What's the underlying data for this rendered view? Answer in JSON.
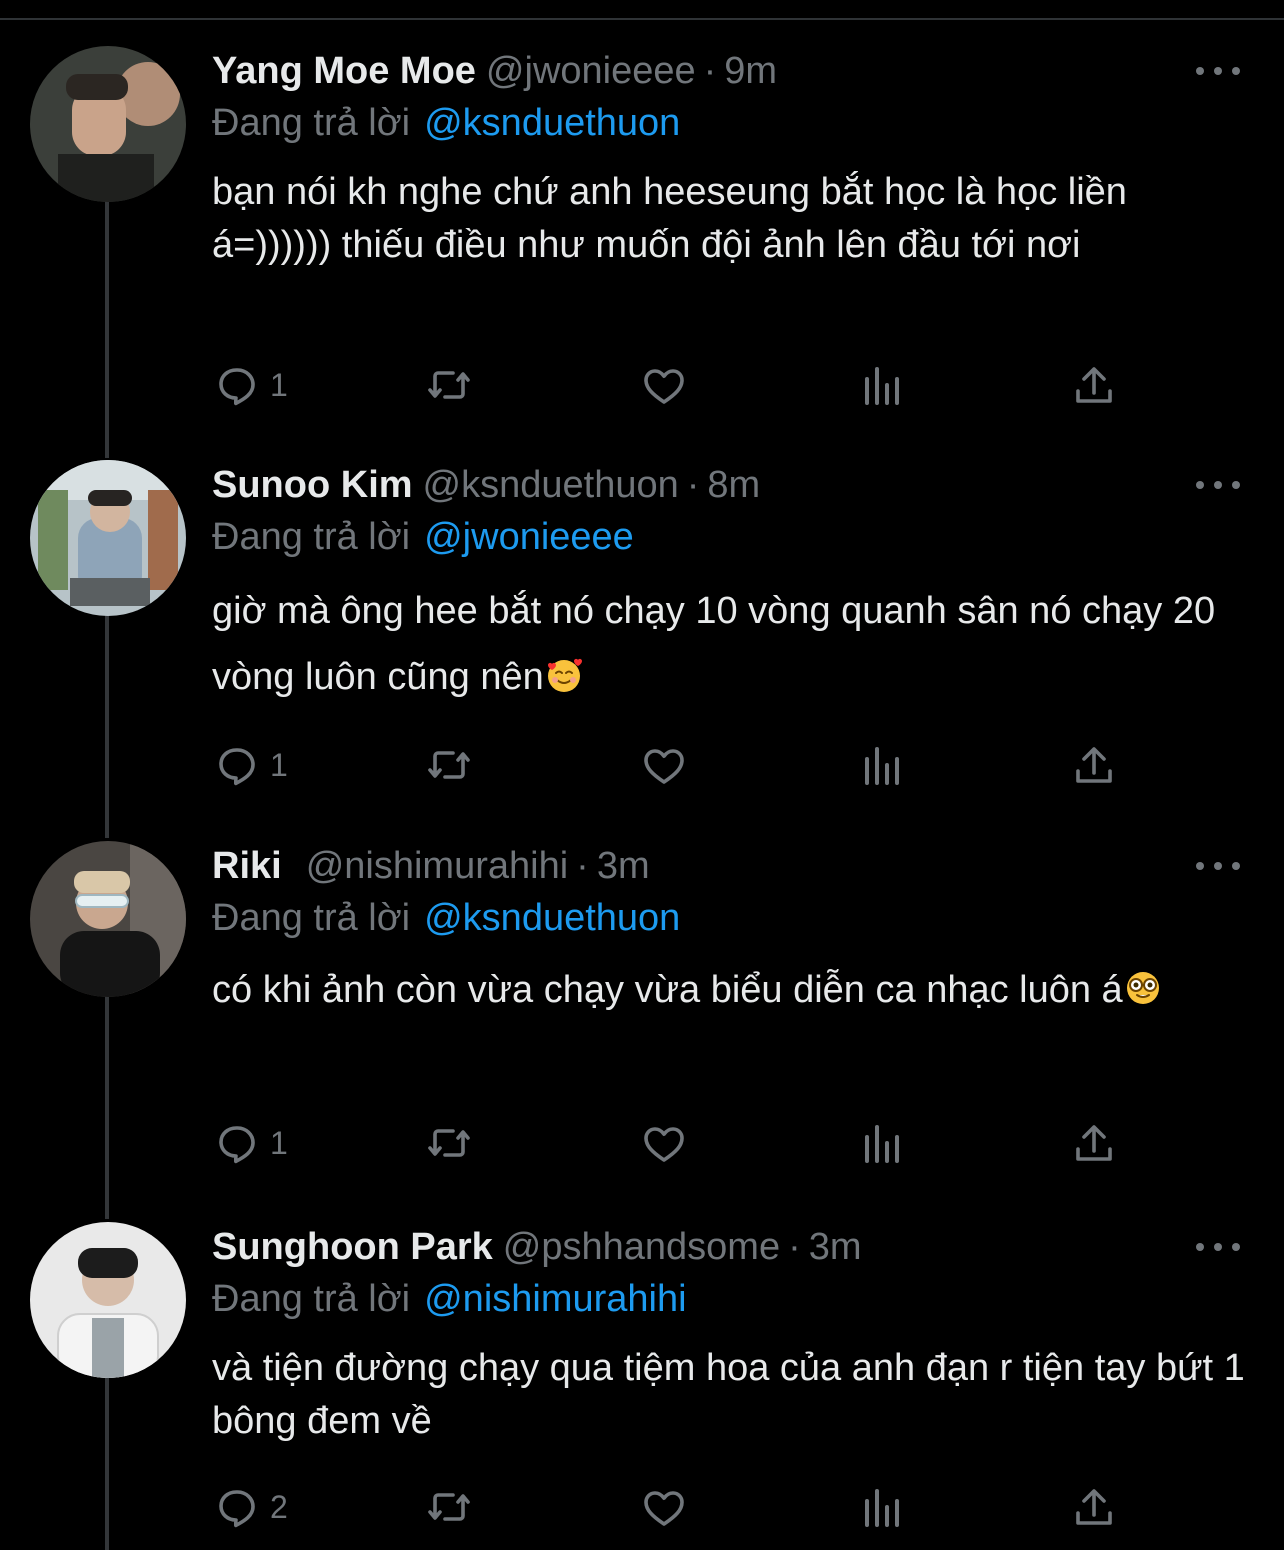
{
  "reply_label": "Đang trả lời",
  "tweets": [
    {
      "name": "Yang Moe Moe",
      "handle": "@jwonieeee",
      "time": "9m",
      "reply_to": "@ksnduethuon",
      "text": "bạn nói kh nghe chứ anh heeseung bắt học là học liền á=)))))) thiếu điều như muốn đội ảnh lên đầu tới nơi",
      "emoji": "",
      "reply_count": "1"
    },
    {
      "name": "Sunoo Kim",
      "handle": "@ksnduethuon",
      "time": "8m",
      "reply_to": "@jwonieeee",
      "text": "giờ mà ông hee bắt nó chạy 10 vòng quanh sân nó chạy 20 vòng luôn cũng nên",
      "emoji": "smiling-face-with-hearts",
      "reply_count": "1"
    },
    {
      "name": "Riki",
      "handle": "@nishimurahihi",
      "time": "3m",
      "reply_to": "@ksnduethuon",
      "text": "có khi ảnh còn vừa chạy vừa biểu diễn ca nhạc luôn á",
      "emoji": "nerd-face",
      "reply_count": "1"
    },
    {
      "name": "Sunghoon Park",
      "handle": "@pshhandsome",
      "time": "3m",
      "reply_to": "@nishimurahihi",
      "text": "và tiện đường chạy qua tiệm hoa của anh đạn r tiện tay bứt 1 bông đem về",
      "emoji": "",
      "reply_count": "2"
    }
  ],
  "icons": [
    "reply-icon",
    "retweet-icon",
    "like-icon",
    "views-icon",
    "share-icon",
    "more-icon"
  ],
  "colors": {
    "background": "#000000",
    "text": "#e7e9ea",
    "muted": "#71767b",
    "link": "#1d9bf0"
  }
}
